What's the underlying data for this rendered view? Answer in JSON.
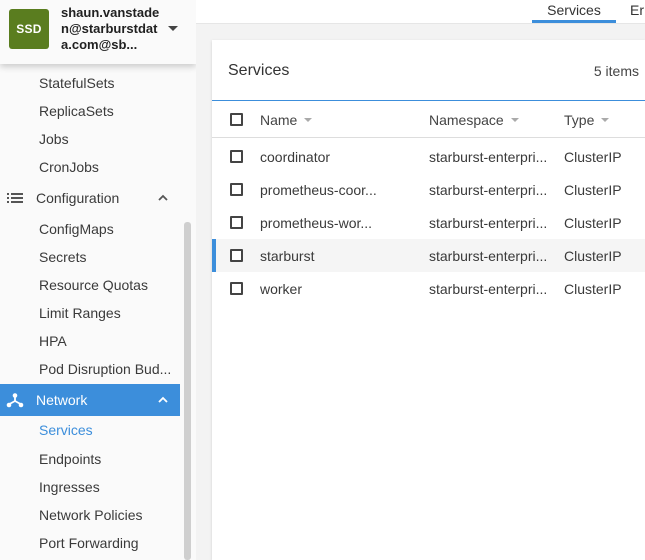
{
  "account": {
    "avatar_text": "SSD",
    "name": "shaun.vanstaden@starburstdata.com@sb..."
  },
  "sidebar": {
    "workloads_items": [
      "StatefulSets",
      "ReplicaSets",
      "Jobs",
      "CronJobs"
    ],
    "configuration": {
      "label": "Configuration",
      "icon": "list-icon",
      "items": [
        "ConfigMaps",
        "Secrets",
        "Resource Quotas",
        "Limit Ranges",
        "HPA",
        "Pod Disruption Bud..."
      ]
    },
    "network": {
      "label": "Network",
      "icon": "network-icon",
      "items": [
        "Services",
        "Endpoints",
        "Ingresses",
        "Network Policies",
        "Port Forwarding"
      ],
      "active_item": "Services"
    }
  },
  "tabs": {
    "services": "Services",
    "next": "Er"
  },
  "services_panel": {
    "title": "Services",
    "count": "5 items",
    "columns": {
      "name": "Name",
      "namespace": "Namespace",
      "type": "Type"
    },
    "rows": [
      {
        "name": "coordinator",
        "namespace": "starburst-enterpri...",
        "type": "ClusterIP"
      },
      {
        "name": "prometheus-coor...",
        "namespace": "starburst-enterpri...",
        "type": "ClusterIP"
      },
      {
        "name": "prometheus-wor...",
        "namespace": "starburst-enterpri...",
        "type": "ClusterIP"
      },
      {
        "name": "starburst",
        "namespace": "starburst-enterpri...",
        "type": "ClusterIP"
      },
      {
        "name": "worker",
        "namespace": "starburst-enterpri...",
        "type": "ClusterIP"
      }
    ],
    "selected_row": "starburst"
  },
  "colors": {
    "accent": "#3c8edb",
    "avatar": "#5a7d1f"
  }
}
